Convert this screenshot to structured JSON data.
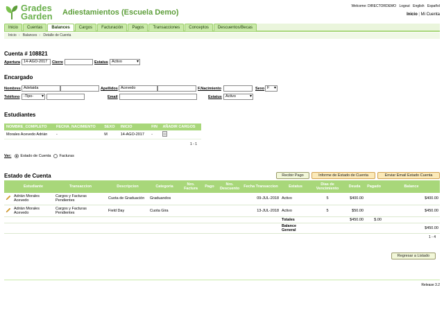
{
  "header": {
    "logo_word1": "Grades",
    "logo_word2": "Garden",
    "app_title": "Adiestamientos (Escuela Demo)",
    "welcome": "Welcome: DIRECTORDEMO",
    "logout": "Logout",
    "lang_en": "English",
    "lang_es": "Español",
    "inicio": "Inicio",
    "mi_cuenta": "Mi Cuenta",
    "separator": "|"
  },
  "nav": {
    "tabs": [
      "Inicio",
      "Cuentas",
      "Balances",
      "Cargos",
      "Facturación",
      "Pagos",
      "Transacciones",
      "Conceptos",
      "Descuentos/Becas"
    ],
    "active_index": 2
  },
  "breadcrumb": [
    "Inicio",
    "Balances",
    "Detalle de Cuenta"
  ],
  "account": {
    "title": "Cuenta # 108821",
    "apertura_label": "Apertura",
    "apertura_value": "14-AGO-2017",
    "cierre_label": "Cierre",
    "cierre_value": "",
    "estatus_label": "Estatus",
    "estatus_value": "Activo"
  },
  "encargado": {
    "title": "Encargado",
    "nombres_label": "Nombres",
    "nombres_1": "Adelaida",
    "nombres_2": "",
    "apellidos_label": "Apellidos",
    "apellidos_1": "Acevedo",
    "apellidos_2": "",
    "nacimiento_label": "F.Nacimiento",
    "nacimiento_value": "",
    "sexo_label": "Sexo",
    "sexo_value": "F",
    "telefono_label": "Teléfono",
    "telefono_tipo": "-Tipo-",
    "telefono_value": "",
    "email_label": "Email",
    "email_value": "",
    "estatus_label": "Estatus",
    "estatus_value": "Activo"
  },
  "estudiantes": {
    "title": "Estudiantes",
    "columns": [
      "NOMBRE_COMPLETO",
      "FECHA_NACIMIENTO",
      "SEXO",
      "INICIO",
      "FIN",
      "AÑADIR CARGOS"
    ],
    "rows": [
      [
        "Morales Acevedo Adrián",
        "-",
        "M",
        "14-AGO-2017",
        "-",
        ""
      ]
    ],
    "pager": "1 - 1"
  },
  "ver": {
    "label": "Ver:",
    "option1": "Estado de Cuenta",
    "option2": "Facturas",
    "selected": "Estado de Cuenta"
  },
  "estado": {
    "title": "Estado de Cuenta",
    "btn_recibir": "Recibir Pago",
    "btn_informe": "Informe de Estado de Cuenta",
    "btn_email": "Enviar Email Estado Cuenta",
    "columns": [
      "",
      "Estudiante",
      "Transaccion",
      "Descripcion",
      "Categoria",
      "Nro. Factura",
      "Pago",
      "Nro. Descuento",
      "Fecha Transaccion",
      "Estatus",
      "Dias de Vencimiento",
      "Deuda",
      "Pagado",
      "Balance"
    ],
    "rows": [
      [
        "",
        "Adrián Morales Acevedo",
        "Cargos y Facturas Pendientes",
        "Cuota de Graduación",
        "Graduandos",
        "",
        "",
        "",
        "09-JUL-2018",
        "Activo",
        "5",
        "$400.00",
        "",
        "$400.00"
      ],
      [
        "",
        "Adrián Morales Acevedo",
        "Cargos y Facturas Pendientes",
        "Field Day",
        "Cuota Gira",
        "",
        "",
        "",
        "13-JUL-2018",
        "Activo",
        "5",
        "$50.00",
        "",
        "$450.00"
      ]
    ],
    "totales_label": "Totales",
    "totales_deuda": "$450.00",
    "totales_pagado": "$.00",
    "balance_label": "Balance General",
    "balance_value": "$450.00",
    "pager": "1 - 4",
    "btn_regresar": "Regresar a Listado"
  },
  "footer": {
    "release": "Release 3.2"
  }
}
